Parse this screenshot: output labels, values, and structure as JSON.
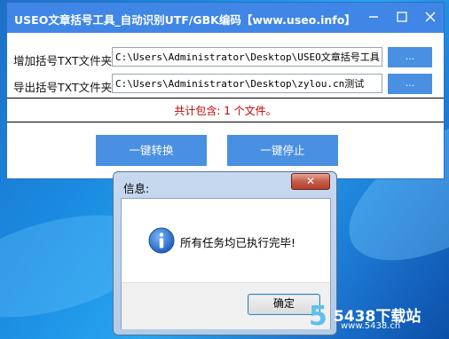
{
  "window": {
    "title": "USEO文章括号工具_自动识别UTF/GBK编码【www.useo.info】",
    "minimize_icon": "minimize-icon",
    "maximize_icon": "maximize-icon",
    "close_icon": "close-icon"
  },
  "form": {
    "input_label": "增加括号TXT文件夹:",
    "input_path": "C:\\Users\\Administrator\\Desktop\\USEO文章括号工具",
    "input_browse": "...",
    "output_label": "导出括号TXT文件夹:",
    "output_path": "C:\\Users\\Administrator\\Desktop\\zylou.cn测试",
    "output_browse": "..."
  },
  "status": {
    "text": "共计包含: 1 个文件。",
    "color": "#c00000"
  },
  "actions": {
    "convert": "一键转换",
    "stop": "一键停止"
  },
  "dialog": {
    "title": "信息:",
    "close_glyph": "✕",
    "icon": "info-icon",
    "message": "所有任务均已执行完毕!",
    "ok": "确定"
  },
  "watermark": {
    "brand": "5438下载站",
    "url": "www.5438.cn",
    "logo_digit": "5"
  },
  "colors": {
    "accent": "#4a90e2",
    "titlebar": "#3f86e6",
    "desktop": "#1a8ae0"
  }
}
